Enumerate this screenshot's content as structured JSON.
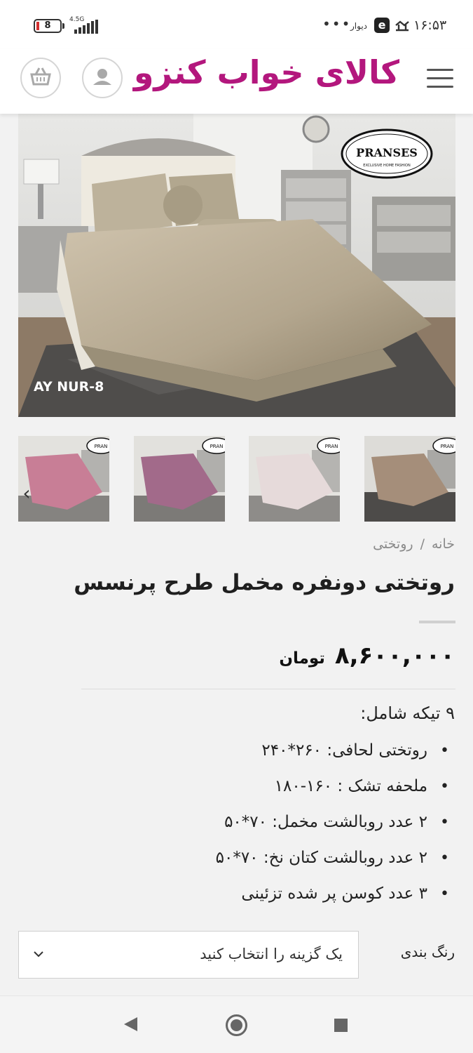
{
  "status_bar": {
    "time": "۱۶:۵۳",
    "battery_level": "8",
    "network": "4.5G",
    "divar_label": "دیوار",
    "e_icon_label": "e",
    "dots": "•••",
    "icons": [
      "battery-icon",
      "signal-icon",
      "divar-icon",
      "e-app-icon",
      "notification-icon"
    ]
  },
  "header": {
    "site_title": "کالای خواب کنزو",
    "icons": [
      "cart-icon",
      "user-icon",
      "hamburger-menu-icon"
    ]
  },
  "gallery": {
    "main_image_caption": "AY NUR-8",
    "brand_logo": "PRANSES",
    "brand_tagline": "EXCLUSIVE HOME FASHION",
    "thumbnails": [
      {
        "color": "#a58e7a",
        "label": "PRAN"
      },
      {
        "color": "#e6dada",
        "label": "PRAN"
      },
      {
        "color": "#a26a8a",
        "label": "PRAN"
      },
      {
        "color": "#c87e96",
        "label": "PRAN"
      }
    ],
    "prev_icon": "chevron-left-icon"
  },
  "breadcrumb": {
    "home": "خانه",
    "separator": "/",
    "category": "روتختی"
  },
  "product": {
    "title": "روتختی دونفره مخمل طرح پرنسس",
    "price": "۸,۶۰۰,۰۰۰",
    "currency": "تومان",
    "description_heading": "۹ تیکه شامل:",
    "features": [
      "روتختی لحافی: ۲۶۰*۲۴۰",
      "ملحفه تشک : ۱۶۰-۱۸۰",
      "۲ عدد روبالشت مخمل: ۷۰*۵۰",
      "۲ عدد روبالشت کتان نخ: ۷۰*۵۰",
      "۳ عدد کوسن پر شده تزئینی"
    ]
  },
  "variation": {
    "label": "رنگ بندی",
    "placeholder": "یک گزینه را انتخاب کنید",
    "icon": "chevron-down-icon"
  },
  "colors": {
    "brand": "#b3177d",
    "background": "#f2f2f2",
    "text": "#222222"
  }
}
